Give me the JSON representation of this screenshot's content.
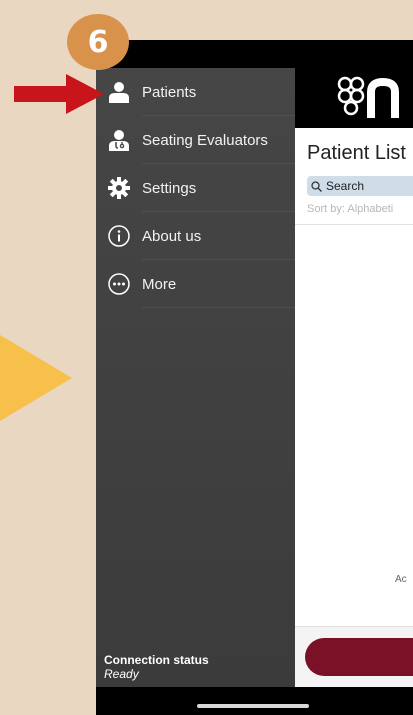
{
  "step": {
    "number": "6"
  },
  "drawer": {
    "items": [
      {
        "label": "Patients",
        "icon": "user-icon"
      },
      {
        "label": "Seating Evaluators",
        "icon": "doctor-icon"
      },
      {
        "label": "Settings",
        "icon": "gear-icon"
      },
      {
        "label": "About us",
        "icon": "info-icon"
      },
      {
        "label": "More",
        "icon": "more-icon"
      }
    ],
    "connection": {
      "title": "Connection status",
      "status": "Ready"
    }
  },
  "app": {
    "title": "Patient List",
    "search_placeholder": "Search",
    "sort_label": "Sort by: Alphabeti",
    "partial_text": "Ac"
  },
  "colors": {
    "background": "#ead7c2",
    "badge": "#d9924c",
    "arrow": "#c8151b",
    "triangle": "#f7c04a",
    "drawer": "#444444",
    "accent": "#7a1126"
  }
}
